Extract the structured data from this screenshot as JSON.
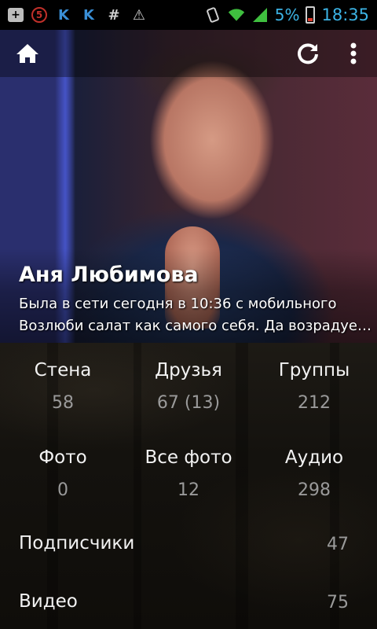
{
  "status_bar": {
    "battery_percent": "5%",
    "time": "18:35",
    "icons": [
      "plus-box-icon",
      "five-badge-icon",
      "k-icon",
      "k-icon",
      "hash-icon",
      "warning-icon",
      "rotate-icon",
      "wifi-icon",
      "signal-icon",
      "battery-icon"
    ]
  },
  "toolbar": {
    "home_icon": "home-icon",
    "refresh_icon": "refresh-icon",
    "menu_icon": "more-vert-icon"
  },
  "profile": {
    "name": "Аня Любимова",
    "status": "Была в сети сегодня в 10:36 с мобильного",
    "quote": "Возлюби салат как самого себя.  Да возрадуется"
  },
  "counters": {
    "row1": [
      {
        "label": "Стена",
        "value": "58"
      },
      {
        "label": "Друзья",
        "value": "67 (13)"
      },
      {
        "label": "Группы",
        "value": "212"
      }
    ],
    "row2": [
      {
        "label": "Фото",
        "value": "0"
      },
      {
        "label": "Все фото",
        "value": "12"
      },
      {
        "label": "Аудио",
        "value": "298"
      }
    ]
  },
  "list": [
    {
      "label": "Подписчики",
      "value": "47"
    },
    {
      "label": "Видео",
      "value": "75"
    }
  ],
  "colors": {
    "accent": "#3cb4e6",
    "value_gray": "#9a9a9a"
  }
}
